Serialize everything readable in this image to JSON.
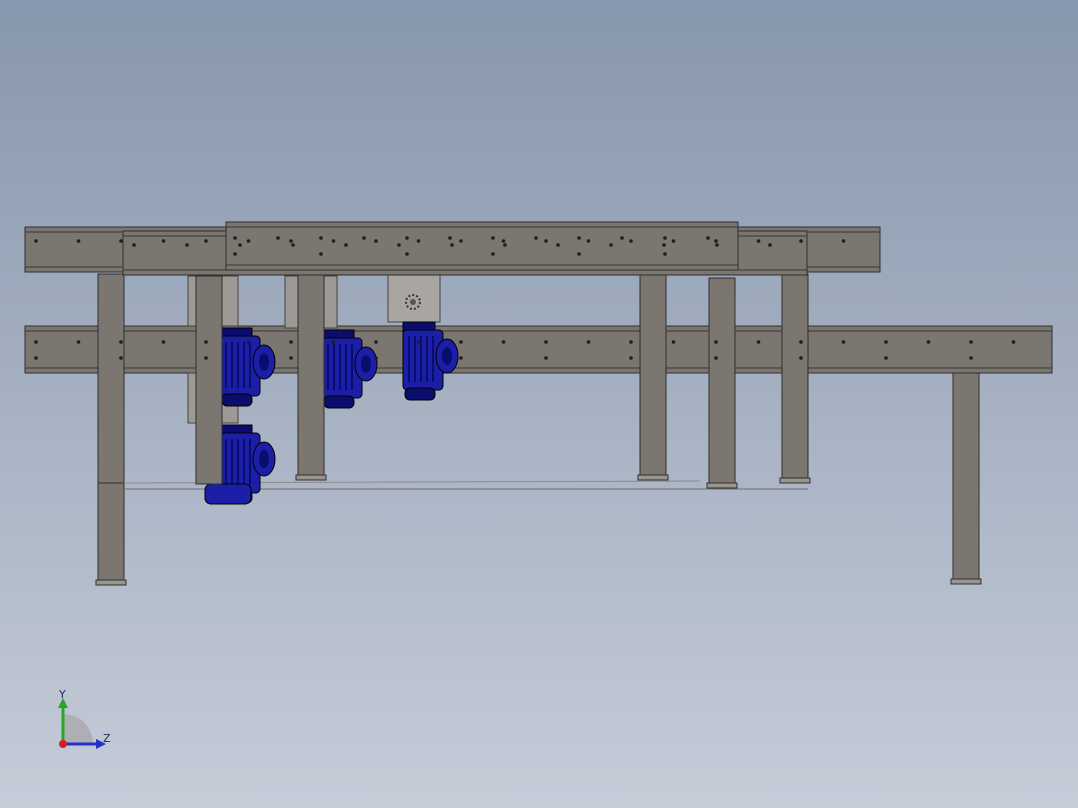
{
  "app": {
    "viewport_background_top": "#8797ad",
    "viewport_background_bottom": "#c6ccd8"
  },
  "model": {
    "frame_color": "#7b766f",
    "frame_edge_color": "#2f2f2f",
    "motor_color": "#1b1fa8",
    "motor_dark_color": "#0b0d6e",
    "components": {
      "conveyor_beams": 4,
      "support_legs": 9,
      "gear_motors": 4
    }
  },
  "triad": {
    "y_label": "Y",
    "z_label": "Z",
    "y_axis_color": "#2aa52a",
    "z_axis_color": "#2233cc",
    "origin_color": "#cc2222",
    "icon": "coordinate-triad-icon"
  }
}
